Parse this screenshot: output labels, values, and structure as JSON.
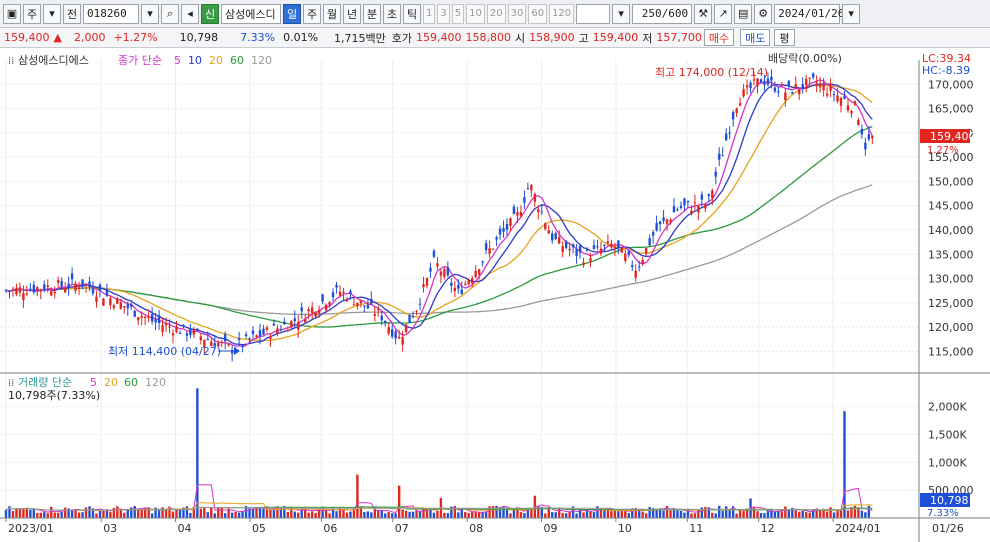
{
  "toolbar": {
    "market": "주",
    "code_label": "전",
    "code": "018260",
    "name_badge": "신",
    "name": "삼성에스디",
    "periods": [
      "일",
      "주",
      "월",
      "년",
      "분",
      "초",
      "틱"
    ],
    "active_period": "일",
    "minute_options": [
      "1",
      "3",
      "5",
      "10",
      "20",
      "30",
      "60",
      "120"
    ],
    "count": "250/600",
    "date": "2024/01/26"
  },
  "quote": {
    "price": "159,400",
    "change": "2,000",
    "change_pct": "+1.27%",
    "volume": "10,798",
    "vol_ratio": "7.33%",
    "turnover": "0.01%",
    "amount": "1,715백만",
    "bid_ask_label": "호가",
    "bid": "159,400",
    "ask": "158,800",
    "open_label": "시",
    "open": "158,900",
    "high_label": "고",
    "high": "159,400",
    "low_label": "저",
    "low": "157,700",
    "buy": "매수",
    "sell": "매도",
    "eval": "평"
  },
  "price_legend": {
    "name": "삼성에스디에스",
    "label": "종가 단순",
    "periods": [
      "5",
      "10",
      "20",
      "60",
      "120"
    ],
    "colors": [
      "#d633c8",
      "#2f39c8",
      "#e6a31c",
      "#2c9a3e",
      "#9a9a9a"
    ]
  },
  "volume_legend": {
    "label": "거래량 단순",
    "periods": [
      "5",
      "20",
      "60",
      "120"
    ],
    "colors": [
      "#d633c8",
      "#e6a31c",
      "#2c9a3e",
      "#9a9a9a"
    ],
    "current": "10,798주(7.33%)"
  },
  "annotations": {
    "max": "최고 174,000 (12/14)",
    "min": "최저 114,400 (04/27)",
    "dividend": "배당락(0.00%)"
  },
  "indicators": {
    "lc": "LC:39.34",
    "hc": "HC:-8.39",
    "price_tag": "159,400",
    "pct_tag": "1.27%",
    "vol_tag": "10,798",
    "vol_pct_tag": "7.33%"
  },
  "chart_data": {
    "type": "candlestick",
    "x_labels": [
      "2023/01",
      "03",
      "04",
      "05",
      "06",
      "07",
      "08",
      "09",
      "10",
      "11",
      "12",
      "2024/01",
      "01/26"
    ],
    "price_ticks": [
      "170,000",
      "165,000",
      "160,000",
      "155,000",
      "150,000",
      "145,000",
      "140,000",
      "135,000",
      "130,000",
      "125,000",
      "120,000",
      "115,000"
    ],
    "price_ylim": [
      112000,
      175000
    ],
    "volume_ticks": [
      "2,000K",
      "1,500K",
      "1,000K",
      "500,000"
    ],
    "volume_ylim": [
      0,
      2300000
    ],
    "close_keyframes": [
      {
        "m": 0,
        "v": 127500
      },
      {
        "m": 1.3,
        "v": 129000
      },
      {
        "m": 2.5,
        "v": 121000
      },
      {
        "m": 3.2,
        "v": 118500
      },
      {
        "m": 3.8,
        "v": 115500
      },
      {
        "m": 4.2,
        "v": 118000
      },
      {
        "m": 4.8,
        "v": 121000
      },
      {
        "m": 5.6,
        "v": 127500
      },
      {
        "m": 6.3,
        "v": 122500
      },
      {
        "m": 6.6,
        "v": 117500
      },
      {
        "m": 6.9,
        "v": 124000
      },
      {
        "m": 7.2,
        "v": 133500
      },
      {
        "m": 7.6,
        "v": 127000
      },
      {
        "m": 8.1,
        "v": 135500
      },
      {
        "m": 8.6,
        "v": 143000
      },
      {
        "m": 8.8,
        "v": 149500
      },
      {
        "m": 9.2,
        "v": 138000
      },
      {
        "m": 9.7,
        "v": 134500
      },
      {
        "m": 10.2,
        "v": 137000
      },
      {
        "m": 10.6,
        "v": 132000
      },
      {
        "m": 10.9,
        "v": 139500
      },
      {
        "m": 11.3,
        "v": 144500
      },
      {
        "m": 11.8,
        "v": 145500
      },
      {
        "m": 12.3,
        "v": 167000
      },
      {
        "m": 12.7,
        "v": 171000
      },
      {
        "m": 13.1,
        "v": 168500
      },
      {
        "m": 13.6,
        "v": 170500
      },
      {
        "m": 14.0,
        "v": 167500
      },
      {
        "m": 14.3,
        "v": 165000
      },
      {
        "m": 14.45,
        "v": 157000
      },
      {
        "m": 14.56,
        "v": 159400
      }
    ],
    "volume_spikes": [
      {
        "m": 3.2,
        "v": 2330000
      },
      {
        "m": 5.9,
        "v": 780000
      },
      {
        "m": 6.6,
        "v": 580000
      },
      {
        "m": 7.3,
        "v": 360000
      },
      {
        "m": 8.9,
        "v": 400000
      },
      {
        "m": 12.5,
        "v": 350000
      },
      {
        "m": 14.1,
        "v": 1920000
      }
    ]
  }
}
